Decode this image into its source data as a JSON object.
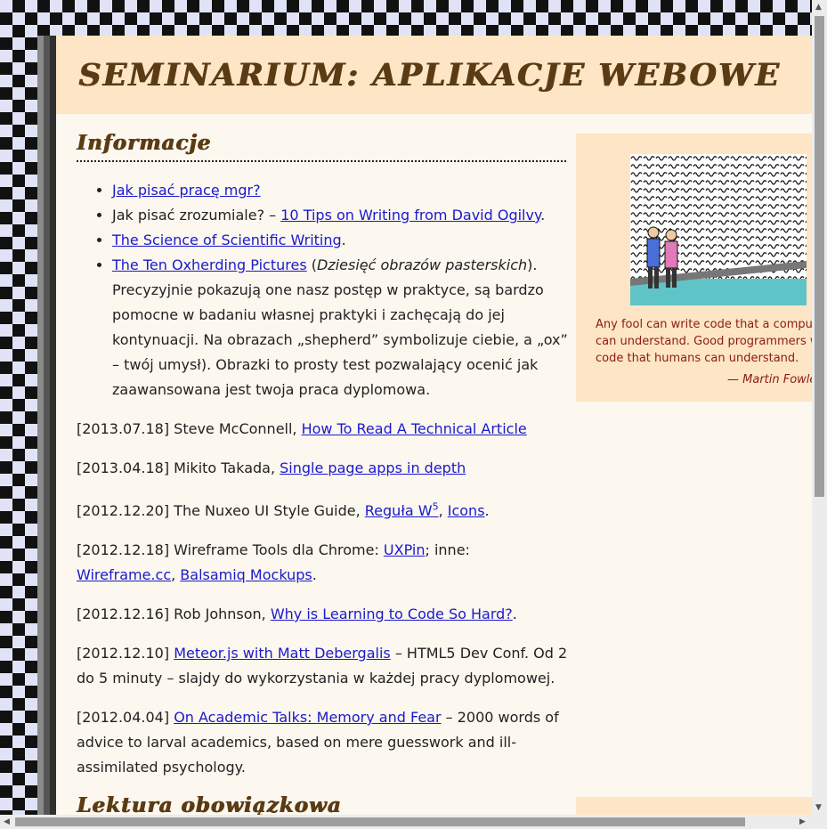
{
  "header": {
    "title": "SEMINARIUM: APLIKACJE WEBOWE"
  },
  "main": {
    "section_title": "Informacje",
    "list": [
      {
        "link": "Jak pisać pracę mgr?"
      },
      {
        "pre": "Jak pisać zrozumiale? – ",
        "link": "10 Tips on Writing from David Ogilvy",
        "post": "."
      },
      {
        "link": "The Science of Scientific Writing",
        "post": "."
      },
      {
        "link": "The Ten Oxherding Pictures",
        "pre2": " (",
        "em": "Dziesięć obrazów pasterskich",
        "post": "). Precyzyjnie pokazują one nasz postęp w praktyce, są bardzo pomocne w badaniu własnej praktyki i zachęcają do jej kontynuacji. Na obrazach „shepherd” symbolizuje ciebie, a „ox” – twój umysł). Obrazki to prosty test pozwalający ocenić jak zaawansowana jest twoja praca dyplomowa."
      }
    ],
    "news": [
      {
        "text": "[2013.07.18] Steve McConnell, ",
        "link": "How To Read A Technical Article"
      },
      {
        "text": "[2013.04.18] Mikito Takada, ",
        "link": "Single page apps in depth"
      },
      {
        "text": "[2012.12.20] The Nuxeo UI Style Guide, ",
        "link": "Reguła W",
        "sup": "5",
        "sep": ", ",
        "link2": "Icons",
        "post": "."
      },
      {
        "text": "[2012.12.18] Wireframe Tools dla Chrome: ",
        "link": "UXPin",
        "sep": "; inne: ",
        "link2": "Wireframe.cc",
        "sep2": ", ",
        "link3": "Balsamiq Mockups",
        "post": "."
      },
      {
        "text": "[2012.12.16] Rob Johnson, ",
        "link": "Why is Learning to Code So Hard?",
        "post": "."
      },
      {
        "text": "[2012.12.10] ",
        "link": "Meteor.js with Matt Debergalis",
        "post": " – HTML5 Dev Conf. Od 2 do 5 minuty – slajdy do wykorzystania w każdej pracy dyplomowej."
      },
      {
        "text": "[2012.04.04] ",
        "link": "On Academic Talks: Memory and Fear",
        "post": " – 2000 words of advice to larval academics, based on mere guesswork and ill-assimilated psychology."
      }
    ],
    "next_section_title": "Lektura obowiązkowa"
  },
  "sidebar": {
    "quote_lines": [
      "Any fool can write code that a comput",
      "can understand. Good programmers w",
      "code that humans can understand."
    ],
    "author": "— Martin Fowle"
  },
  "colors": {
    "accent": "#5b3b14",
    "link": "#1a1acc",
    "sidebar_bg": "#fde5c5",
    "page_bg": "#fcf7ef",
    "quote": "#8a1c10"
  }
}
